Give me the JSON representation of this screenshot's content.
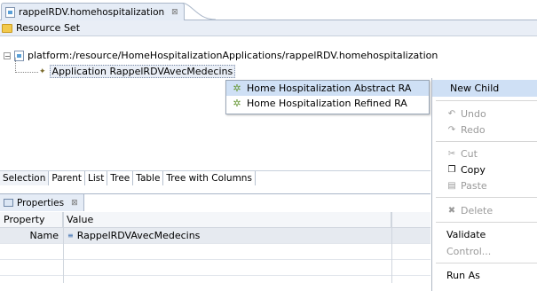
{
  "editor": {
    "tab_title": "rappelRDV.homehospitalization",
    "close_glyph": "⊠"
  },
  "resource_set": {
    "label": "Resource Set"
  },
  "tree": {
    "root_label": "platform:/resource/HomeHospitalizationApplications/rappelRDV.homehospitalization",
    "child_label": "Application RappelRDVAvecMedecins",
    "expander_glyph": "−"
  },
  "new_child_submenu": {
    "items": [
      {
        "label": "Home Hospitalization Abstract RA",
        "icon": "gear-icon"
      },
      {
        "label": "Home Hospitalization Refined RA",
        "icon": "gear-icon"
      }
    ]
  },
  "context_menu": {
    "new_child": "New Child",
    "undo": "Undo",
    "redo": "Redo",
    "cut": "Cut",
    "copy": "Copy",
    "paste": "Paste",
    "delete": "Delete",
    "validate": "Validate",
    "control": "Control...",
    "run_as": "Run As"
  },
  "bottom_tabs": [
    "Selection",
    "Parent",
    "List",
    "Tree",
    "Table",
    "Tree with Columns"
  ],
  "properties": {
    "tab_title": "Properties",
    "close_glyph": "⊠",
    "columns": {
      "property": "Property",
      "value": "Value"
    },
    "rows": [
      {
        "property": "Name",
        "value": "RappelRDVAvecMedecins"
      }
    ]
  },
  "colors": {
    "selection": "#cfe0f5",
    "tab_bg": "#e5ecf6",
    "border": "#a9b6c8"
  }
}
